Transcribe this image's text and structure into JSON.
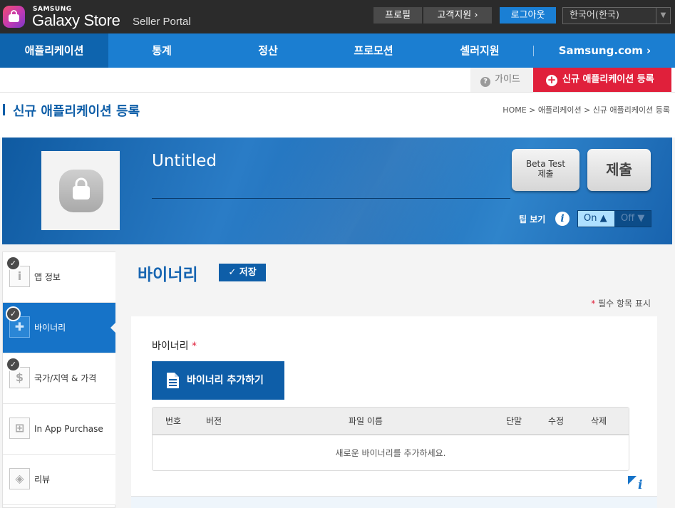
{
  "header": {
    "samsung": "SAMSUNG",
    "store": "Galaxy Store",
    "portal": "Seller Portal",
    "profile": "프로필",
    "support": "고객지원 ›",
    "logout": "로그아웃",
    "language": "한국어(한국)"
  },
  "nav": {
    "items": [
      "애플리케이션",
      "통계",
      "정산",
      "프로모션",
      "셀러지원",
      "Samsung.com ›"
    ],
    "active": "애플리케이션"
  },
  "subbar": {
    "guide": "가이드",
    "new_app": "신규 애플리케이션 등록"
  },
  "page": {
    "title": "신규 애플리케이션 등록",
    "breadcrumb": "HOME  >  애플리케이션  >  신규 애플리케이션 등록"
  },
  "banner": {
    "app_title": "Untitled",
    "beta_line1": "Beta Test",
    "beta_line2": "제출",
    "submit": "제출",
    "tip_label": "팁 보기",
    "tip_on": "On",
    "tip_off": "Off",
    "tip_state": "On"
  },
  "sidebar": {
    "items": [
      {
        "label": "앱 정보",
        "checked": true,
        "icon": "info-icon"
      },
      {
        "label": "바이너리",
        "checked": true,
        "icon": "binary-icon",
        "active": true
      },
      {
        "label": "국가/지역 & 가격",
        "checked": true,
        "icon": "dollar-icon"
      },
      {
        "label": "In App Purchase",
        "checked": false,
        "icon": "iap-icon"
      },
      {
        "label": "리뷰",
        "checked": false,
        "icon": "review-icon"
      }
    ]
  },
  "content": {
    "section_title": "바이너리",
    "save": "저장",
    "required_note": "필수 항목 표시",
    "field_label": "바이너리",
    "add_binary": "바이너리 추가하기",
    "table": {
      "columns": [
        "번호",
        "버전",
        "파일 이름",
        "단말",
        "수정",
        "삭제"
      ],
      "empty": "새로운 바이너리를 추가하세요."
    }
  },
  "colors": {
    "brand_blue": "#1b7ed1",
    "accent_red": "#e0203b",
    "dark_top": "#2b2b2b"
  }
}
